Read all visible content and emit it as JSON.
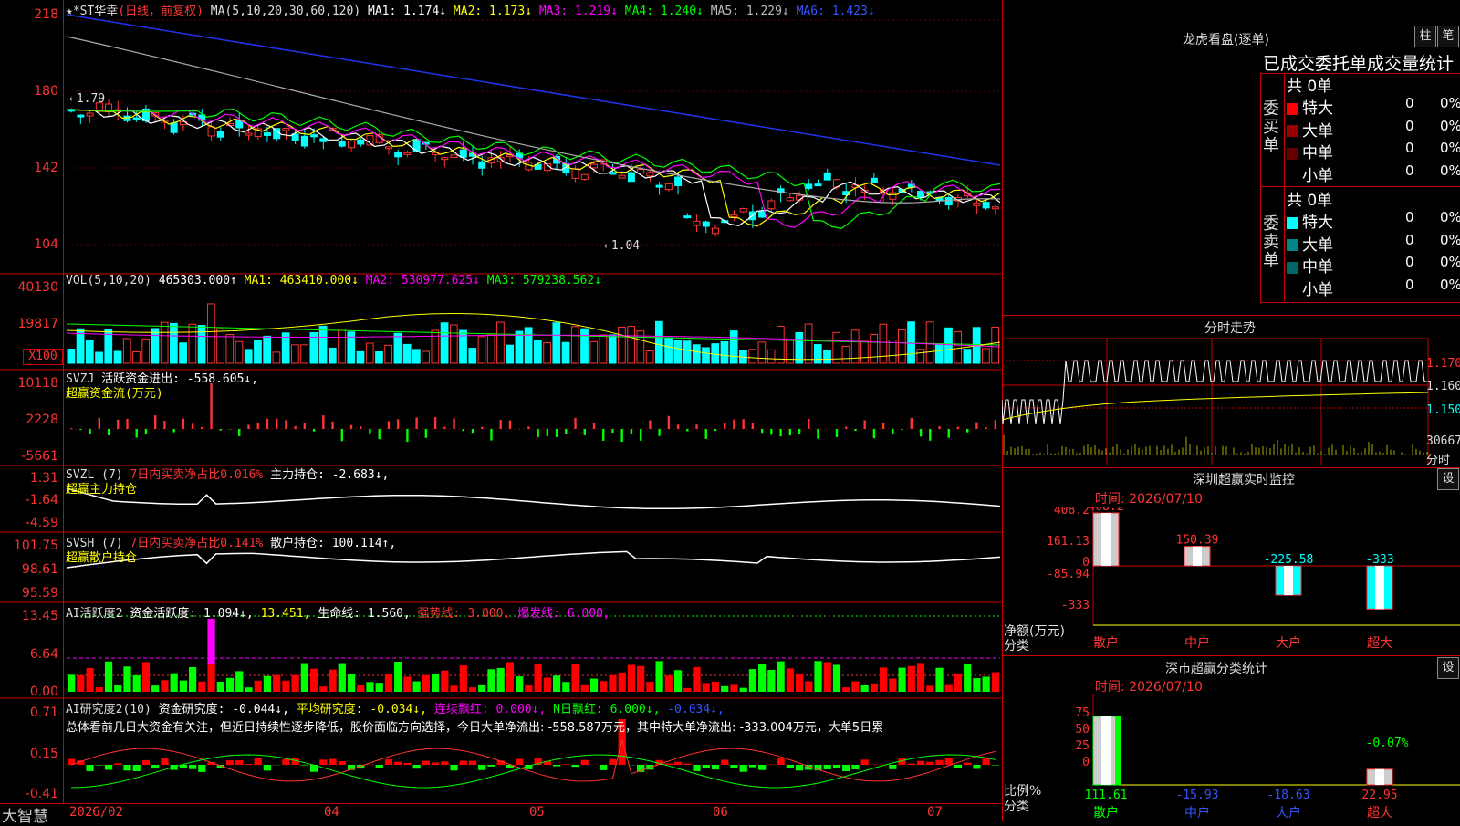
{
  "candle_header": {
    "stock": "★*ST华幸",
    "period": "(日线，前复权)",
    "ma_def": "MA(5,10,20,30,60,120)",
    "ma1": "MA1: 1.174↓",
    "ma2": "MA2: 1.173↓",
    "ma3": "MA3: 1.219↓",
    "ma4": "MA4: 1.240↓",
    "ma5": "MA5: 1.229↓",
    "ma6": "MA6: 1.423↓"
  },
  "candle_axis": [
    "218",
    "180",
    "142",
    "104"
  ],
  "candle_marks": {
    "high": "1.79",
    "low": "1.04"
  },
  "vol_header": {
    "def": "VOL(5,10,20)",
    "val": "465303.000↑",
    "ma1": "MA1: 463410.000↓",
    "ma2": "MA2: 530977.625↓",
    "ma3": "MA3: 579238.562↓"
  },
  "vol_axis": [
    "40130",
    "19817",
    "X100"
  ],
  "svzj_header": {
    "def": "SVZJ",
    "val": "活跃资金进出: -558.605↓,",
    "sub": "超赢资金流(万元)"
  },
  "svzj_axis": [
    "10118",
    "2228",
    "-5661"
  ],
  "svzl_header": {
    "def": "SVZL (7)",
    "val": "7日内买卖净占比0.016%",
    "val2": "主力持仓: -2.683↓,",
    "sub": "超赢主力持仓"
  },
  "svzl_axis": [
    "1.31",
    "-1.64",
    "-4.59"
  ],
  "svsh_header": {
    "def": "SVSH (7)",
    "val": "7日内买卖净占比0.141%",
    "val2": "散户持仓: 100.114↑,",
    "sub": "超赢散户持仓"
  },
  "svsh_axis": [
    "101.75",
    "98.61",
    "95.59"
  ],
  "ai_active": {
    "def": "AI活跃度2",
    "a": "资金活跃度: 1.094↓,",
    "b": "13.451,",
    "c": "生命线: 1.560,",
    "d": "强势线: 3.000,",
    "e": "爆发线: 6.000,"
  },
  "ai_active_axis": [
    "13.45",
    "6.64",
    "0.00"
  ],
  "ai_research": {
    "def": "AI研究度2(10)",
    "a": "资金研究度: -0.044↓,",
    "b": "平均研究度: -0.034↓,",
    "c": "连续飘红: 0.000↓,",
    "d": "N日飘红: 6.000↓,",
    "e": "-0.034↓,"
  },
  "ai_research_text": "总体看前几日大资金有关注，但近日持续性逐步降低，股价面临方向选择，今日大单净流出: -558.587万元，其中特大单净流出: -333.004万元，大单5日累",
  "ai_research_axis": [
    "0.71",
    "0.15",
    "-0.41"
  ],
  "x_axis": [
    "2026/02",
    "04",
    "05",
    "06",
    "07"
  ],
  "brand": "大智慧",
  "right_panel": {
    "title": "龙虎看盘(逐单)",
    "btn_a": "柱",
    "btn_b": "笔",
    "subtitle": "已成交委托单成交量统计",
    "buy_label": "委买单",
    "sell_label": "委卖单",
    "buy_total": "共 0单",
    "sell_total": "共 0单",
    "buy_rows": [
      {
        "name": "特大",
        "count": "0",
        "pct": "0%",
        "color": "#ff0000"
      },
      {
        "name": "大单",
        "count": "0",
        "pct": "0%",
        "color": "#990000"
      },
      {
        "name": "中单",
        "count": "0",
        "pct": "0%",
        "color": "#660000"
      },
      {
        "name": "小单",
        "count": "0",
        "pct": "0%",
        "color": "#000000"
      }
    ],
    "sell_rows": [
      {
        "name": "特大",
        "count": "0",
        "pct": "0%",
        "color": "#00ffff"
      },
      {
        "name": "大单",
        "count": "0",
        "pct": "0%",
        "color": "#008888"
      },
      {
        "name": "中单",
        "count": "0",
        "pct": "0%",
        "color": "#006666"
      },
      {
        "name": "小单",
        "count": "0",
        "pct": "0%",
        "color": "#000000"
      }
    ]
  },
  "intraday": {
    "title": "分时走势",
    "axis": [
      "1.170",
      "1.160",
      "1.150"
    ],
    "vol": "30667",
    "vol_label": "分时"
  },
  "monitor": {
    "title": "深圳超赢实时监控",
    "btn": "设",
    "time": "时间: 2026/07/10",
    "axis": [
      "408.2",
      "161.13",
      "0",
      "-85.94",
      "-333"
    ],
    "ylabel": "净额(万元)",
    "xlabel": "分类",
    "cats": [
      "散户",
      "中户",
      "大户",
      "超大"
    ],
    "values": [
      "408.2",
      "150.39",
      "-225.58",
      "-333"
    ]
  },
  "classify": {
    "title": "深市超赢分类统计",
    "btn": "设",
    "time": "时间: 2026/07/10",
    "axis": [
      "75",
      "50",
      "25",
      "0"
    ],
    "ylabel": "比例%",
    "xlabel": "分类",
    "top_label": "-0.07%",
    "cats": [
      "散户",
      "中户",
      "大户",
      "超大"
    ],
    "values": [
      "111.61",
      "-15.93",
      "-18.63",
      "22.95"
    ]
  },
  "chart_data": [
    {
      "type": "line",
      "title": "★*ST华幸(日线，前复权)",
      "ylim": [
        104,
        218
      ],
      "series_desc": [
        "MA1",
        "MA2",
        "MA3",
        "MA4",
        "MA5",
        "MA6"
      ],
      "values_last": [
        1.174,
        1.173,
        1.219,
        1.24,
        1.229,
        1.423
      ]
    },
    {
      "type": "bar",
      "title": "超赢资金流(万元)",
      "ylim": [
        -5661,
        10118
      ],
      "last": -558.605
    },
    {
      "type": "bar",
      "title": "深圳超赢实时监控",
      "categories": [
        "散户",
        "中户",
        "大户",
        "超大"
      ],
      "values": [
        408.2,
        150.39,
        -225.58,
        -333
      ],
      "ylim": [
        -333,
        408.2
      ]
    },
    {
      "type": "bar",
      "title": "深市超赢分类统计",
      "categories": [
        "散户",
        "中户",
        "大户",
        "超大"
      ],
      "values": [
        111.61,
        -15.93,
        -18.63,
        22.95
      ],
      "ylim": [
        0,
        75
      ]
    }
  ]
}
